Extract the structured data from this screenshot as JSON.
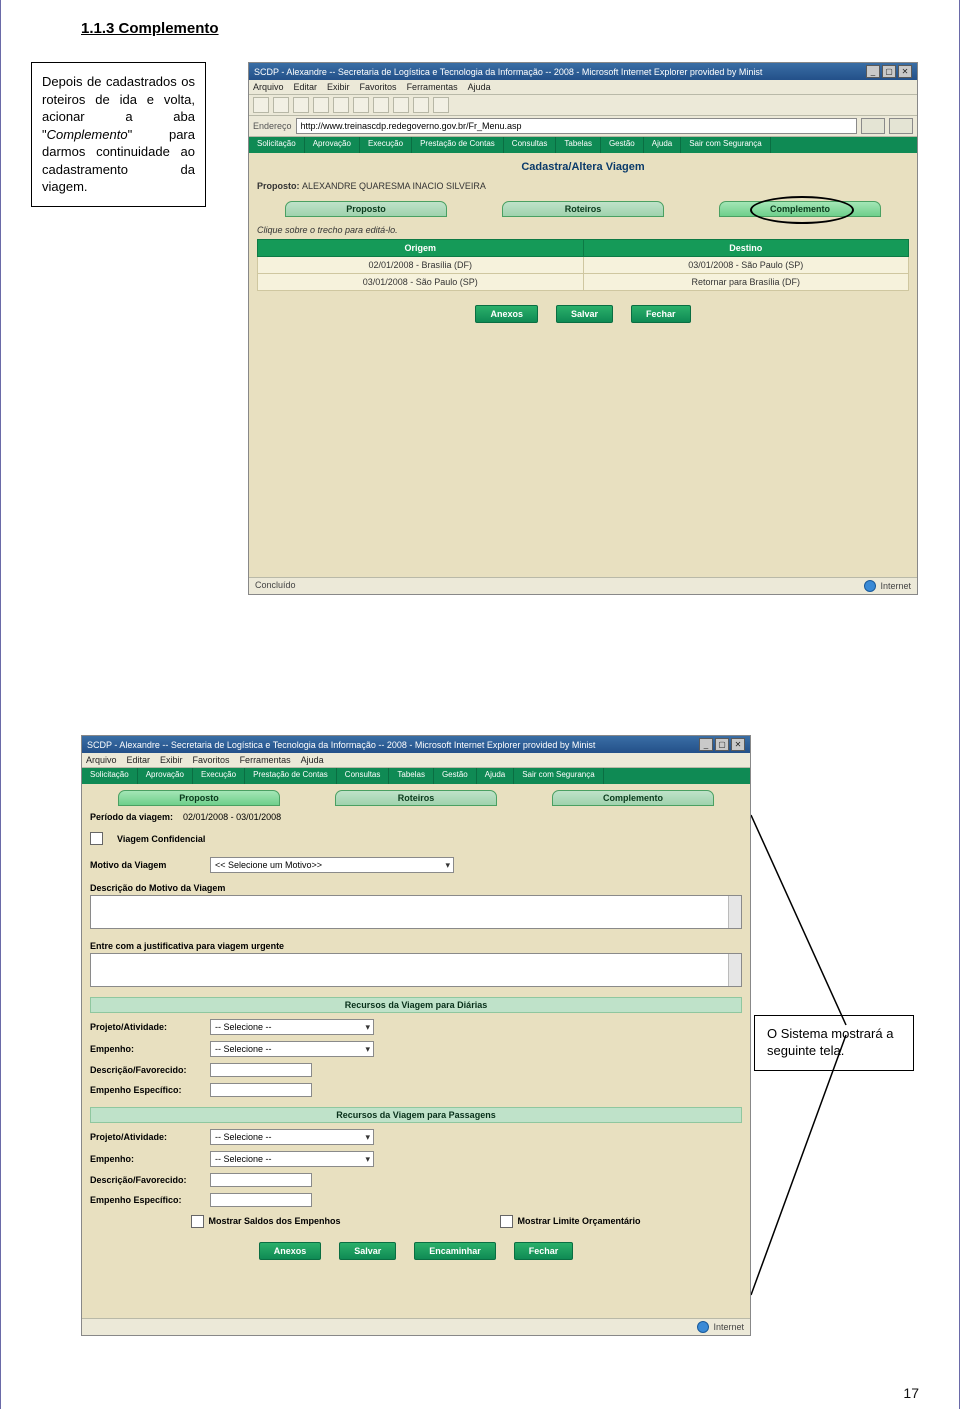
{
  "doc": {
    "heading": "1.1.3 Complemento",
    "page_number": "17"
  },
  "callout_top": {
    "line1": "Depois de cadastrados os roteiros de ida e volta, acionar a aba \"",
    "italic": "Complemento",
    "line2": "\" para darmos continuidade ao cadastramento da viagem."
  },
  "callout_bottom": "O Sistema mostrará a seguinte tela.",
  "browser": {
    "title": "SCDP - Alexandre -- Secretaria de Logística e Tecnologia da Informação -- 2008 - Microsoft Internet Explorer provided by Minist",
    "menu": [
      "Arquivo",
      "Editar",
      "Exibir",
      "Favoritos",
      "Ferramentas",
      "Ajuda"
    ],
    "address_label": "Endereço",
    "address_value": "http://www.treinascdp.redegoverno.gov.br/Fr_Menu.asp",
    "sys_tabs": [
      "Solicitação",
      "Aprovação",
      "Execução",
      "Prestação de Contas",
      "Consultas",
      "Tabelas",
      "Gestão",
      "Ajuda",
      "Sair com Segurança"
    ],
    "status_left": "Concluído",
    "status_right": "Internet"
  },
  "screen1": {
    "page_title": "Cadastra/Altera Viagem",
    "proposto_label": "Proposto:",
    "proposto_value": "ALEXANDRE QUARESMA INACIO SILVEIRA",
    "tabs": [
      "Proposto",
      "Roteiros",
      "Complemento"
    ],
    "edit_hint": "Clique sobre o trecho para editá-lo.",
    "cols": [
      "Origem",
      "Destino"
    ],
    "rows": [
      [
        "02/01/2008 - Brasília (DF)",
        "03/01/2008 - São Paulo (SP)"
      ],
      [
        "03/01/2008 - São Paulo (SP)",
        "Retornar para Brasília (DF)"
      ]
    ],
    "buttons": [
      "Anexos",
      "Salvar",
      "Fechar"
    ]
  },
  "screen2": {
    "tabs": [
      "Proposto",
      "Roteiros",
      "Complemento"
    ],
    "periodo_label": "Período da viagem:",
    "periodo_value": "02/01/2008 - 03/01/2008",
    "confidencial": "Viagem Confidencial",
    "motivo_label": "Motivo da Viagem",
    "motivo_select": "<< Selecione um Motivo>>",
    "desc_label": "Descrição do Motivo da Viagem",
    "justif_label": "Entre com a justificativa para viagem urgente",
    "sec_diarias": "Recursos da Viagem para Diárias",
    "sec_passagens": "Recursos da Viagem para Passagens",
    "labels": {
      "projeto": "Projeto/Atividade:",
      "empenho": "Empenho:",
      "descr": "Descrição/Favorecido:",
      "emp_espec": "Empenho Específico:"
    },
    "sel_placeholder": "-- Selecione --",
    "chk_saldos": "Mostrar Saldos dos Empenhos",
    "chk_limite": "Mostrar Limite Orçamentário",
    "buttons": [
      "Anexos",
      "Salvar",
      "Encaminhar",
      "Fechar"
    ]
  }
}
